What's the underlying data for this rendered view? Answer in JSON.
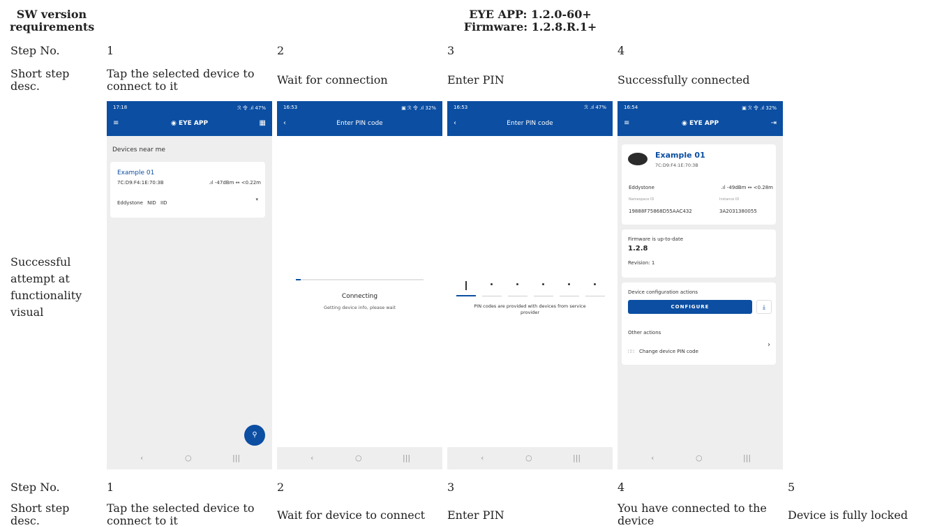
{
  "header": {
    "sw_req": "SW version requirements",
    "eye_app": "EYE APP: 1.2.0-60+",
    "firmware": "Firmware: 1.2.8.R.1+"
  },
  "row1": {
    "step_label": "Step No.",
    "desc_label": "Short step desc.",
    "steps": [
      "1",
      "2",
      "3",
      "4"
    ],
    "descs": [
      "Tap the selected device to connect to it",
      "Wait for connection",
      "Enter PIN",
      "Successfully connected"
    ]
  },
  "row_visual_label": "Successful attempt at functionality visual",
  "row2": {
    "step_label": "Step No.",
    "desc_label": "Short step desc.",
    "steps": [
      "1",
      "2",
      "3",
      "4",
      "5"
    ],
    "descs": [
      "Tap the selected device to connect to it",
      "Wait for device to connect",
      "Enter PIN",
      "You have connected to the device",
      "Device is fully locked"
    ]
  },
  "phone1": {
    "time": "17:18",
    "status": "ℛ 令 .ıl 47%",
    "app_title": "EYE APP",
    "section": "Devices near me",
    "device_name": "Example 01",
    "mac": "7C:D9:F4:1E:70:3B",
    "signal": ".ıl -47dBm ↔ <0.22m",
    "tags": [
      "Eddystone",
      "NID",
      "IID"
    ]
  },
  "phone2": {
    "time": "16:53",
    "status": "▣ ℛ 令 .ıl 32%",
    "app_title": "Enter PIN code",
    "connecting": "Connecting",
    "wait": "Getting device info, please wait"
  },
  "phone3": {
    "time": "16:53",
    "status": "ℛ .ıl 47%",
    "app_title": "Enter PIN code",
    "pin_note": "PIN codes are provided with devices from service provider"
  },
  "phone4": {
    "time": "16:54",
    "status": "▣ ℛ 令 .ıl 32%",
    "app_title": "EYE APP",
    "device_name": "Example 01",
    "mac": "7C:D9:F4:1E:70:3B",
    "protocol": "Eddystone",
    "signal": ".ıl -49dBm ↔ <0.28m",
    "ns_label": "Namespace ID",
    "ns_value": "19888F75868D55AAC432",
    "inst_label": "Instance ID",
    "inst_value": "3A2031380055",
    "fw_status": "Firmware is up-to-date",
    "fw_version": "1.2.8",
    "revision": "Revision: 1",
    "config_title": "Device configuration actions",
    "configure": "CONFIGURE",
    "other_actions": "Other actions",
    "change_pin": "Change device PIN code"
  },
  "colors": {
    "primary": "#0b4ea2",
    "background": "#eeeeee"
  }
}
